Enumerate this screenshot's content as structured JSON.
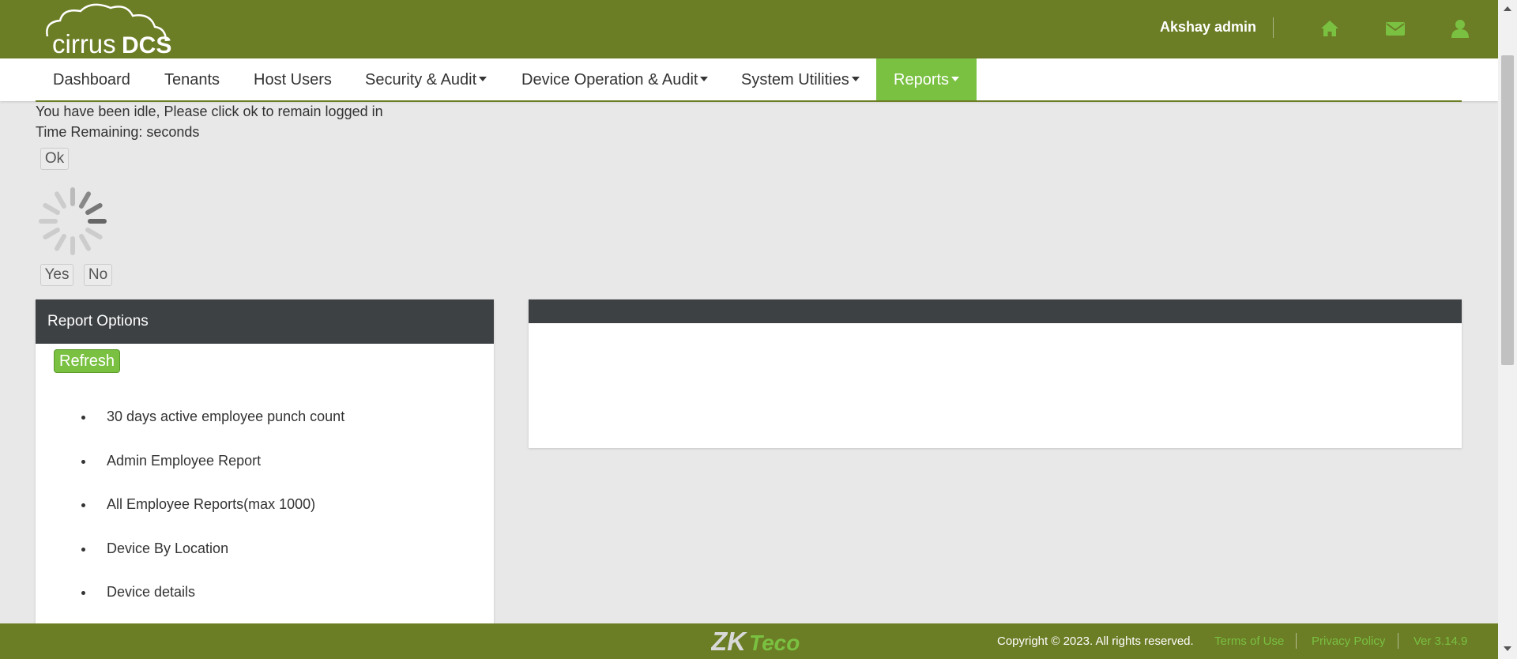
{
  "header": {
    "logo_text_light": "cirrus",
    "logo_text_bold": "DCS",
    "user_name": "Akshay admin",
    "icons": [
      "home-icon",
      "envelope-icon",
      "user-icon"
    ]
  },
  "nav": {
    "items": [
      {
        "label": "Dashboard",
        "dropdown": false
      },
      {
        "label": "Tenants",
        "dropdown": false
      },
      {
        "label": "Host Users",
        "dropdown": false
      },
      {
        "label": "Security & Audit",
        "dropdown": true
      },
      {
        "label": "Device Operation & Audit",
        "dropdown": true
      },
      {
        "label": "System Utilities",
        "dropdown": true
      },
      {
        "label": "Reports",
        "dropdown": true,
        "active": true
      }
    ]
  },
  "idle_dialog": {
    "message": "You have been idle, Please click ok to remain logged in",
    "time_remaining": "Time Remaining: seconds",
    "ok_label": "Ok",
    "yes_label": "Yes",
    "no_label": "No"
  },
  "report_options": {
    "title": "Report Options",
    "refresh_label": "Refresh",
    "items": [
      "30 days active employee punch count",
      "Admin Employee Report",
      "All Employee Reports(max 1000)",
      "Device By Location",
      "Device details"
    ]
  },
  "footer": {
    "brand_zk": "ZK",
    "brand_teco": "Teco",
    "copyright": "Copyright © 2023. All rights reserved.",
    "terms_label": "Terms of Use",
    "privacy_label": "Privacy Policy",
    "version": "Ver 3.14.9"
  },
  "colors": {
    "header_bg": "#6b7d25",
    "accent_green": "#7ac142",
    "panel_header": "#3d4144",
    "page_bg": "#e8e8e8"
  }
}
